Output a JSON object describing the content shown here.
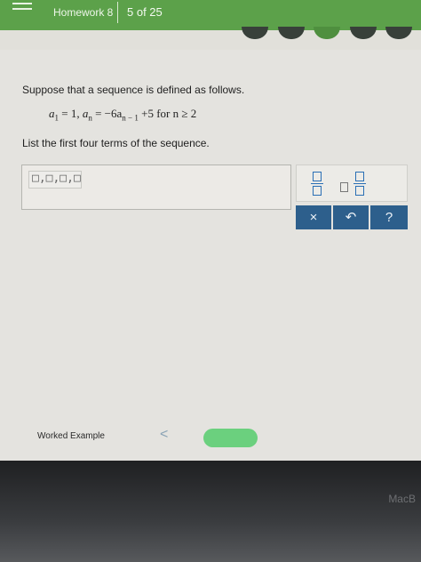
{
  "header": {
    "title": "Homework 8",
    "count": "5 of 25"
  },
  "problem": {
    "intro": "Suppose that a sequence is defined as follows.",
    "formula_part1": "a",
    "formula_sub1": "1",
    "formula_part2": " = 1,   ",
    "formula_part3": "a",
    "formula_sub3": "n",
    "formula_part4": " = −6a",
    "formula_sub4": "n − 1",
    "formula_part5": " +5   for   n ≥ 2",
    "instruction": "List the first four terms of the sequence.",
    "answer_value": "□,□,□,□"
  },
  "tools": {
    "clear_label": "×",
    "undo_label": "↶",
    "help_label": "?"
  },
  "footer": {
    "worked_example": "Worked Example",
    "back_label": "<",
    "bezel": "MacB"
  },
  "colors": {
    "header_green": "#5ca14a",
    "tool_blue": "#2d5f8c",
    "next_green": "#6bd07e"
  },
  "icons": [
    "menu-icon",
    "fraction-icon",
    "mixed-number-icon",
    "close-icon",
    "undo-icon",
    "help-icon",
    "chevron-left-icon"
  ]
}
